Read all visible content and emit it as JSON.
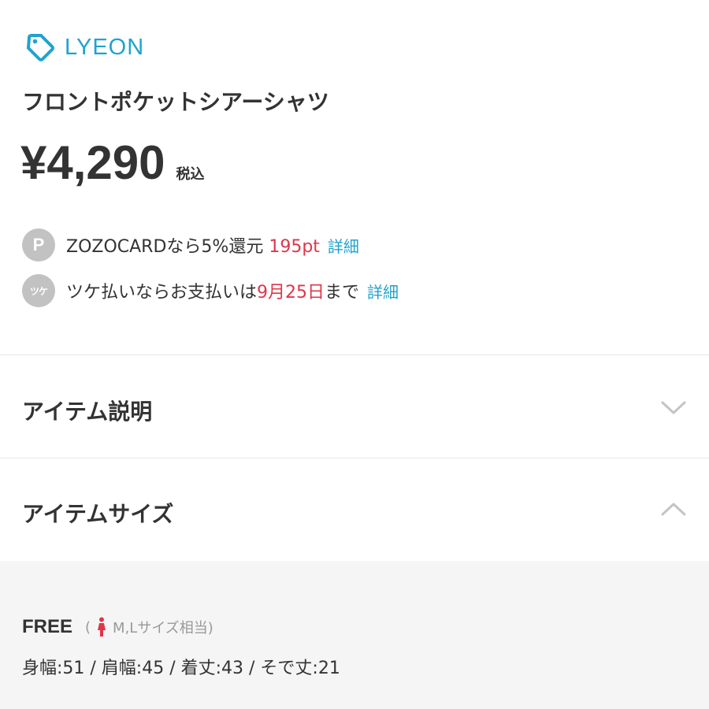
{
  "brand": {
    "name": "LYEON",
    "color": "#1fa3cf"
  },
  "product": {
    "title": "フロントポケットシアーシャツ",
    "price": "¥4,290",
    "tax_label": "税込"
  },
  "benefits": {
    "card": {
      "badge": "P",
      "text": "ZOZOCARDなら5%還元",
      "points": "195pt",
      "link": "詳細"
    },
    "tsuke": {
      "badge": "ツケ",
      "text_before": "ツケ払いならお支払いは",
      "date": "9月25日",
      "text_after": "まで",
      "link": "詳細"
    }
  },
  "sections": {
    "description": {
      "title": "アイテム説明",
      "icon": "chevron-down-icon",
      "expanded": false
    },
    "size": {
      "title": "アイテムサイズ",
      "icon": "chevron-up-icon",
      "expanded": true
    }
  },
  "size_chart": {
    "name": "FREE",
    "note_open": "(",
    "note_icon": "person-icon",
    "note_text": "M,Lサイズ相当)",
    "measurements": "身幅:51 / 肩幅:45 / 着丈:43 / そで丈:21"
  },
  "colors": {
    "accent": "#1fa3cf",
    "highlight": "#e0354a",
    "badge": "#c2c2c2",
    "panel_background": "#f5f5f5",
    "person_icon": "#e0354a"
  }
}
